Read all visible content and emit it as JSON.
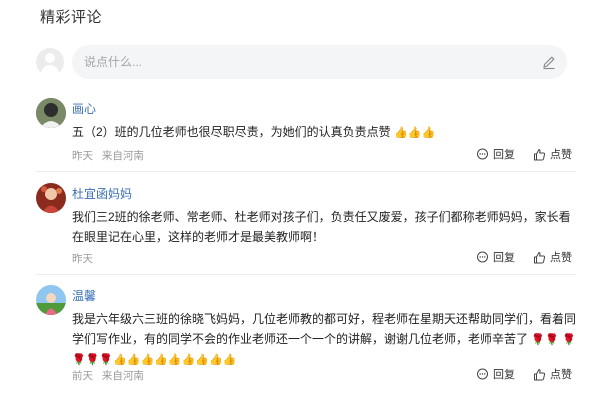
{
  "section_title": "精彩评论",
  "compose": {
    "placeholder": "说点什么...",
    "pen_icon": "pen-icon"
  },
  "comments": [
    {
      "name": "画心",
      "content": "五（2）班的几位老师也很尽职尽责，为她们的认真负责点赞",
      "trailing_emojis": [
        "👍",
        "👍",
        "👍"
      ],
      "time": "昨天",
      "location": "来自河南",
      "reply_label": "回复",
      "like_label": "点赞"
    },
    {
      "name": "杜宜函妈妈",
      "content": "我们三2班的徐老师、常老师、杜老师对孩子们，负责任又废爱，孩子们都称老师妈妈，家长看在眼里记在心里，这样的老师才是最美教师啊！",
      "trailing_emojis": [],
      "time": "昨天",
      "location": "",
      "reply_label": "回复",
      "like_label": "点赞"
    },
    {
      "name": "温馨",
      "content": "我是六年级六三班的徐晓飞妈妈，几位老师教的都可好，程老师在星期天还帮助同学们，看着同学们写作业，有的同学不会的作业老师还一个一个的讲解，谢谢几位老师，老师辛苦了",
      "trailing_emojis": [
        "🌹",
        "🌹",
        "🌹",
        "🌹",
        "🌹",
        "🌹",
        "👍",
        "👍",
        "👍",
        "👍",
        "👍",
        "👍",
        "👍",
        "👍",
        "👍"
      ],
      "time": "前天",
      "location": "来自河南",
      "reply_label": "回复",
      "like_label": "点赞"
    }
  ],
  "colors": {
    "name": "#3a6fb5",
    "meta": "#9a9a9a",
    "input_bg": "#f4f5f7"
  }
}
